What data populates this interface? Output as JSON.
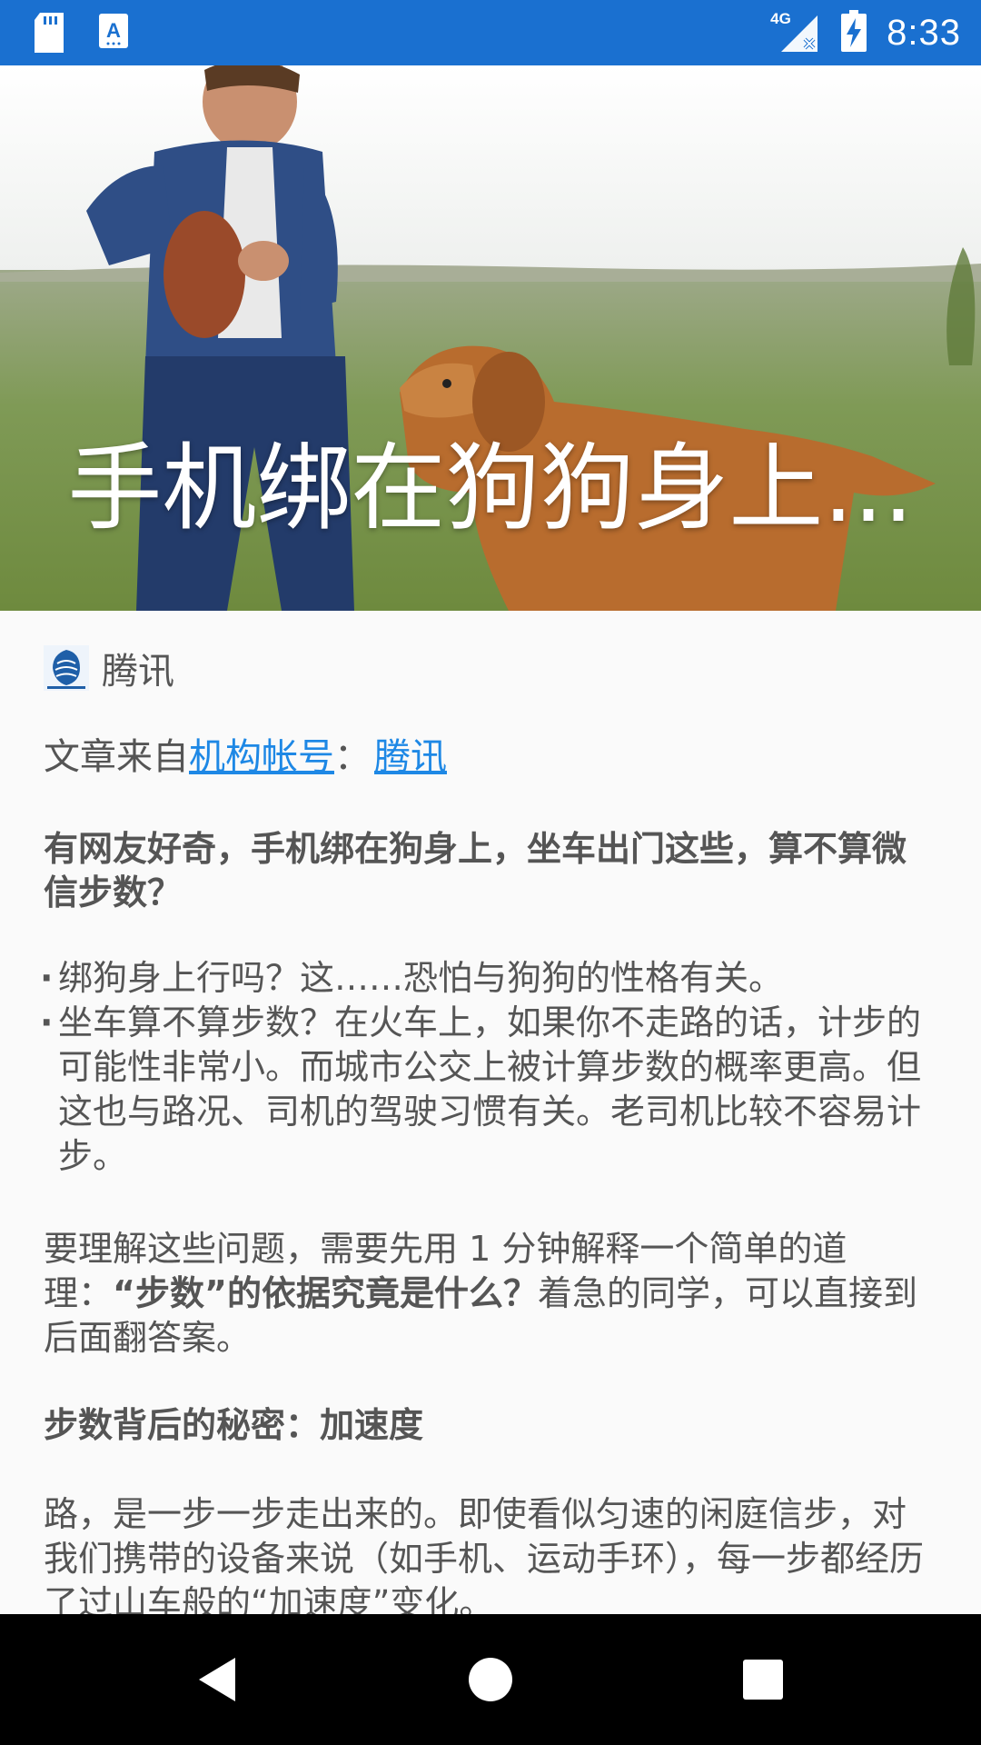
{
  "status_bar": {
    "time": "8:33",
    "network": "4G",
    "icons": [
      "sd-card-icon",
      "keyboard-a-icon",
      "signal-4g-icon",
      "battery-charging-icon"
    ]
  },
  "hero": {
    "title": "手机绑在狗狗身上..."
  },
  "article": {
    "source_name": "腾讯",
    "origin_prefix": "文章来自",
    "origin_account_label": "机构帐号",
    "origin_separator": "：",
    "origin_account_name": "腾讯",
    "question": "有网友好奇，手机绑在狗身上，坐车出门这些，算不算微信步数？",
    "bullets": [
      "绑狗身上行吗？这……恐怕与狗狗的性格有关。",
      "坐车算不算步数？在火车上，如果你不走路的话，计步的可能性非常小。而城市公交上被计算步数的概率更高。但这也与路况、司机的驾驶习惯有关。老司机比较不容易计步。"
    ],
    "para1_start": "要理解这些问题，需要先用 1 分钟解释一个简单的道理：",
    "para1_bold": "“步数”的依据究竟是什么？",
    "para1_end": "着急的同学，可以直接到后面翻答案。",
    "heading": "步数背后的秘密：加速度",
    "para2": "路，是一步一步走出来的。即使看似匀速的闲庭信步，对我们携带的设备来说（如手机、运动手环），每一步都经历了过山车般的“加速度”变化。"
  },
  "nav_bar": {
    "buttons": [
      "back-icon",
      "home-icon",
      "recents-icon"
    ]
  },
  "colors": {
    "status_bar": "#1a70d0",
    "link": "#1e88e5",
    "text": "#555555",
    "background": "#fafafa"
  }
}
